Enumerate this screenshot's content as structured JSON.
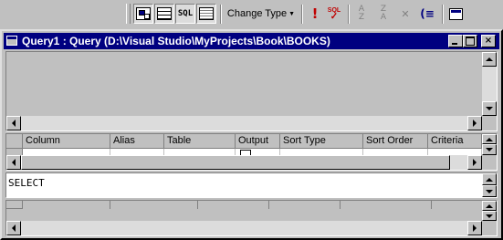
{
  "toolbar": {
    "buttons": [
      {
        "name": "show-diagram-pane",
        "icon": "diagram-pane-icon",
        "pressed": true
      },
      {
        "name": "show-grid-pane",
        "icon": "grid-pane-icon",
        "pressed": true
      },
      {
        "name": "show-sql-pane",
        "icon": "sql-pane-icon",
        "label": "SQL",
        "pressed": true
      },
      {
        "name": "show-results-pane",
        "icon": "results-pane-icon",
        "pressed": true
      }
    ],
    "change_type_label": "Change Type",
    "run_icon": "exclamation-icon",
    "verify_sql_label": "SQL",
    "sort_ascending_label": "A\nZ",
    "sort_descending_label": "Z\nA",
    "remove_filter_icon": "remove-filter-icon",
    "group_by_label": "(≡",
    "add_table_icon": "add-table-icon"
  },
  "window": {
    "title": "Query1 : Query (D:\\Visual Studio\\MyProjects\\Book\\BOOKS)",
    "minimize_icon": "minimize-icon",
    "maximize_icon": "maximize-icon",
    "close_label": "×"
  },
  "grid": {
    "columns": [
      "Column",
      "Alias",
      "Table",
      "Output",
      "Sort Type",
      "Sort Order",
      "Criteria"
    ]
  },
  "sql": {
    "text": "SELECT"
  },
  "colors": {
    "face": "#c0c0c0",
    "titlebar": "#000080",
    "title_text": "#ffffff"
  }
}
